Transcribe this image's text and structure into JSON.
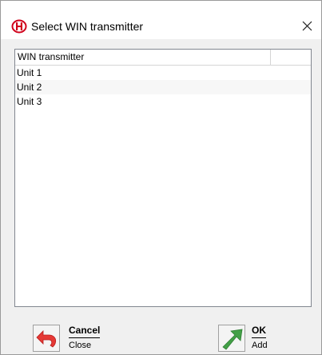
{
  "window": {
    "title": "Select WIN transmitter",
    "icon": "brand-logo-icon",
    "close_icon": "close-icon"
  },
  "list": {
    "columns": [
      "WIN transmitter",
      ""
    ],
    "rows": [
      "Unit 1",
      "Unit 2",
      "Unit 3"
    ]
  },
  "actions": {
    "cancel": {
      "label": "Cancel",
      "sublabel": "Close",
      "icon": "undo-arrow-icon",
      "color": "#e53935"
    },
    "ok": {
      "label": "OK",
      "sublabel": "Add",
      "icon": "up-right-arrow-icon",
      "color": "#43a047"
    }
  },
  "colors": {
    "logo_red": "#d0021b"
  }
}
